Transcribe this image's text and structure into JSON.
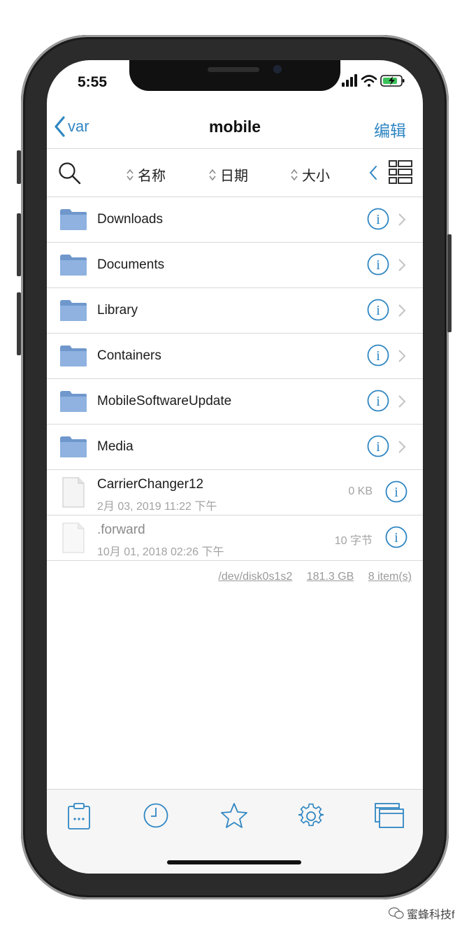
{
  "status_bar": {
    "time": "5:55"
  },
  "nav": {
    "back_label": "var",
    "title": "mobile",
    "edit_label": "编辑"
  },
  "toolbar": {
    "sort_name": "名称",
    "sort_date": "日期",
    "sort_size": "大小"
  },
  "folders": [
    {
      "name": "Downloads"
    },
    {
      "name": "Documents"
    },
    {
      "name": "Library"
    },
    {
      "name": "Containers"
    },
    {
      "name": "MobileSoftwareUpdate"
    },
    {
      "name": "Media"
    }
  ],
  "files": [
    {
      "name": "CarrierChanger12",
      "date": "2月 03, 2019 11:22 下午",
      "size": "0 KB"
    },
    {
      "name": ".forward",
      "date": "10月 01, 2018 02:26 下午",
      "size": "10 字节"
    }
  ],
  "footer": {
    "disk": "/dev/disk0s1s2",
    "capacity": "181.3 GB",
    "items": "8 item(s)"
  },
  "watermark": {
    "text": "蜜蜂科技f"
  },
  "colors": {
    "accent": "#2f86c2",
    "folder": "#7fa6d6",
    "text": "#1c1c1c",
    "muted": "#a3a3a3"
  },
  "icons": {
    "tabs": [
      "clipboard-icon",
      "clock-icon",
      "star-icon",
      "gear-icon",
      "windows-icon"
    ]
  }
}
